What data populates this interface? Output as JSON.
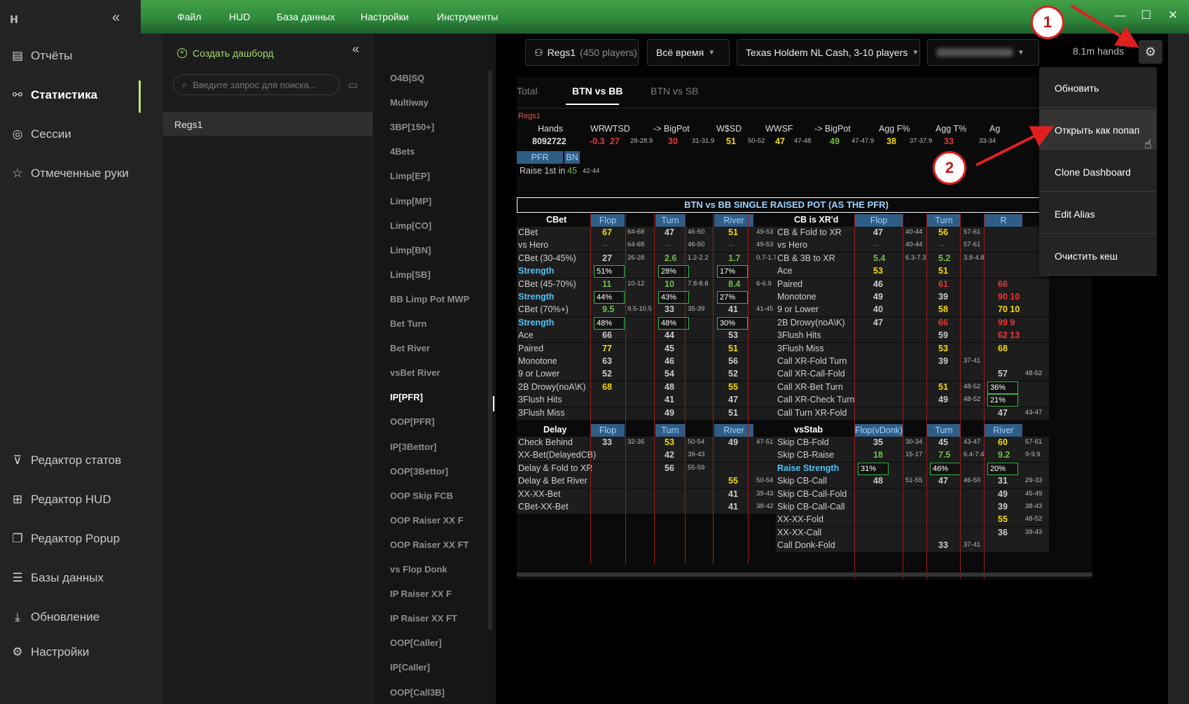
{
  "titlebar": {
    "menu": [
      "Файл",
      "HUD",
      "База данных",
      "Настройки",
      "Инструменты"
    ]
  },
  "nav": {
    "items": [
      {
        "label": "Отчёты",
        "icon": "report-icon"
      },
      {
        "label": "Статистика",
        "icon": "stats-icon",
        "active": true
      },
      {
        "label": "Сессии",
        "icon": "sessions-icon"
      },
      {
        "label": "Отмеченные руки",
        "icon": "star-icon"
      },
      {
        "label": "Редактор статов",
        "icon": "filter-icon"
      },
      {
        "label": "Редактор HUD",
        "icon": "hud-icon"
      },
      {
        "label": "Редактор Popup",
        "icon": "popup-icon"
      },
      {
        "label": "Базы данных",
        "icon": "database-icon"
      },
      {
        "label": "Обновление",
        "icon": "download-icon"
      },
      {
        "label": "Настройки",
        "icon": "gear-icon"
      }
    ],
    "accent": "#b8e67b"
  },
  "dashpanel": {
    "add_label": "Создать дашборд",
    "search_placeholder": "Введите запрос для поиска...",
    "selected": "Regs1"
  },
  "stats_list": [
    "O4B|SQ",
    "Multiway",
    "3BP[150+]",
    "4Bets",
    "Limp[EP]",
    "Limp[MP]",
    "Limp[CO]",
    "Limp[BN]",
    "Limp[SB]",
    "BB Limp Pot MWP",
    "Bet Turn",
    "Bet River",
    "vsBet River",
    "IP[PFR]",
    "OOP[PFR]",
    "IP[3Bettor]",
    "OOP[3Bettor]",
    "OOP Skip FCB",
    "OOP Raiser XX F",
    "OOP Raiser XX FT",
    "vs Flop Donk",
    "IP Raiser XX F",
    "IP Raiser XX FT",
    "OOP[Caller]",
    "IP[Caller]",
    "OOP[Call3B]"
  ],
  "stats_selected": "IP[PFR]",
  "filters": {
    "player": "Regs1",
    "player_count": "(450 players)",
    "time": "Всё время",
    "game": "Texas Holdem NL Cash, 3-10 players",
    "hands": "8.1m hands"
  },
  "context_menu": [
    "Обновить",
    "Открыть как попап",
    "Clone Dashboard",
    "Edit Alias",
    "Очистить кеш"
  ],
  "annotations": [
    "1",
    "2"
  ],
  "tabs": [
    "Total",
    "BTN vs BB",
    "BTN vs SB"
  ],
  "active_tab": "BTN vs BB",
  "summary": {
    "name": "Regs1",
    "headers": [
      "Hands",
      "WR",
      "WTSD",
      "-> BigPot",
      "W$SD",
      "WWSF",
      "-> BigPot",
      "Agg F%",
      "Agg T%",
      "Ag"
    ],
    "values": [
      "8092722",
      "-0.3",
      "27",
      "28-28.9",
      "30",
      "31-31.9",
      "51",
      "50-52",
      "47",
      "47-48",
      "49",
      "47-47.9",
      "38",
      "37-37.9",
      "33",
      "33-34"
    ]
  },
  "pfr": {
    "label": "PFR",
    "pos": "BN",
    "row": "Raise 1st in",
    "value": "45",
    "range": "42-44"
  },
  "section_title": "BTN vs BB SINGLE RAISED POT (AS THE PFR)",
  "cbet": {
    "header": "CBet",
    "cols": [
      "Flop",
      "Turn",
      "River"
    ],
    "rows": [
      [
        "CBet",
        "67",
        "64-68",
        "47",
        "46-50",
        "51",
        "49-53"
      ],
      [
        "vs Hero",
        "--",
        "64-68",
        "--",
        "46-50",
        "--",
        "49-53"
      ],
      [
        "CBet (30-45%)",
        "27",
        "26-28",
        "2.6",
        "1.2-2.2",
        "1.7",
        "0.7-1.7"
      ],
      [
        "Strength",
        "51% we",
        "",
        "28% we",
        "",
        "17% wea",
        ""
      ],
      [
        "CBet (45-70%)",
        "11",
        "10-12",
        "10",
        "7.8-8.8",
        "8.4",
        "6-6.9"
      ],
      [
        "Strength",
        "44% we",
        "",
        "43% we",
        "",
        "27% wea",
        ""
      ],
      [
        "CBet (70%+)",
        "9.5",
        "9.5-10.5",
        "33",
        "35-39",
        "41",
        "41-45"
      ],
      [
        "Strength",
        "48% we",
        "",
        "48% we",
        "",
        "30% wea",
        ""
      ],
      [
        "Ace",
        "66",
        "",
        "44",
        "",
        "53",
        ""
      ],
      [
        "Paired",
        "77",
        "",
        "45",
        "",
        "51",
        ""
      ],
      [
        "Monotone",
        "63",
        "",
        "46",
        "",
        "56",
        ""
      ],
      [
        "9 or Lower",
        "52",
        "",
        "54",
        "",
        "52",
        ""
      ],
      [
        "2B Drowy(noA\\K)",
        "68",
        "",
        "48",
        "",
        "55",
        ""
      ],
      [
        "3Flush Hits",
        "",
        "",
        "41",
        "",
        "47",
        ""
      ],
      [
        "3Flush Miss",
        "",
        "",
        "49",
        "",
        "51",
        ""
      ]
    ]
  },
  "delay": {
    "header": "Delay",
    "cols": [
      "Flop",
      "Turn",
      "River"
    ],
    "rows": [
      [
        "Check Behind",
        "33",
        "32-36",
        "53",
        "50-54",
        "49",
        "47-51"
      ],
      [
        "XX-Bet(DelayedCB)",
        "",
        "",
        "42",
        "39-43",
        "",
        ""
      ],
      [
        "Delay & Fold to XR",
        "",
        "",
        "56",
        "55-59",
        "",
        ""
      ],
      [
        "Delay & Bet River",
        "",
        "",
        "",
        "",
        "55",
        "50-54"
      ],
      [
        "XX-XX-Bet",
        "",
        "",
        "",
        "",
        "41",
        "39-43"
      ],
      [
        "CBet-XX-Bet",
        "",
        "",
        "",
        "",
        "41",
        "38-42"
      ]
    ]
  },
  "xr": {
    "header": "CB is XR'd",
    "cols": [
      "Flop",
      "Turn",
      "R"
    ],
    "rows": [
      [
        "CB & Fold to XR",
        "47",
        "40-44",
        "56",
        "57-61",
        "",
        ""
      ],
      [
        "vs Hero",
        "--",
        "40-44",
        "--",
        "57-61",
        "",
        ""
      ],
      [
        "CB & 3B to XR",
        "5.4",
        "6.3-7.3",
        "5.2",
        "3.8-4.8",
        "",
        ""
      ],
      [
        "Ace",
        "53",
        "",
        "51",
        "",
        "",
        ""
      ],
      [
        "Paired",
        "46",
        "",
        "61",
        "",
        "66",
        ""
      ],
      [
        "Monotone",
        "49",
        "",
        "39",
        "",
        "90 10",
        ""
      ],
      [
        "9 or Lower",
        "40",
        "",
        "58",
        "",
        "70 10",
        ""
      ],
      [
        "2B Drowy(noA\\K)",
        "47",
        "",
        "66",
        "",
        "99 9",
        ""
      ],
      [
        "3Flush Hits",
        "",
        "",
        "59",
        "",
        "62 13",
        ""
      ],
      [
        "3Flush Miss",
        "",
        "",
        "53",
        "",
        "68",
        ""
      ],
      [
        "Call XR-Fold Turn",
        "",
        "",
        "39",
        "37-41",
        "",
        ""
      ],
      [
        "Call XR-Call-Fold",
        "",
        "",
        "",
        "",
        "57",
        "48-52"
      ],
      [
        "Call XR-Bet Turn",
        "",
        "",
        "51",
        "48-52",
        "36% wea",
        ""
      ],
      [
        "Call XR-Check Turn",
        "",
        "",
        "49",
        "48-52",
        "21% wea",
        ""
      ],
      [
        "Call Turn XR-Fold",
        "",
        "",
        "",
        "",
        "47",
        "43-47"
      ]
    ]
  },
  "vsstab": {
    "header": "vsStab",
    "cols": [
      "Flop(vDonk)",
      "Turn",
      "River"
    ],
    "rows": [
      [
        "Skip CB-Fold",
        "35",
        "30-34",
        "45",
        "43-47",
        "60",
        "57-61"
      ],
      [
        "Skip CB-Raise",
        "18",
        "15-17",
        "7.5",
        "6.4-7.4",
        "9.2",
        "9-9.9"
      ],
      [
        "Raise Strength",
        "31% weak",
        "",
        "46% we",
        "",
        "20% wea",
        ""
      ],
      [
        "Skip CB-Call",
        "48",
        "51-55",
        "47",
        "46-50",
        "31",
        "29-33"
      ],
      [
        "Skip CB-Call-Fold",
        "",
        "",
        "",
        "",
        "49",
        "45-49"
      ],
      [
        "Skip CB-Call-Call",
        "",
        "",
        "",
        "",
        "39",
        "38-43"
      ],
      [
        "XX-XX-Fold",
        "",
        "",
        "",
        "",
        "55",
        "48-52"
      ],
      [
        "XX-XX-Call",
        "",
        "",
        "",
        "",
        "36",
        "39-43"
      ],
      [
        "Call Donk-Fold",
        "",
        "",
        "33",
        "37-41",
        "",
        ""
      ]
    ]
  },
  "colors": {
    "red": "#e53935",
    "yellow": "#f5d90a",
    "green": "#6fbf4a",
    "blue_header": "#2f5d86",
    "brand_green": "#43a047"
  }
}
